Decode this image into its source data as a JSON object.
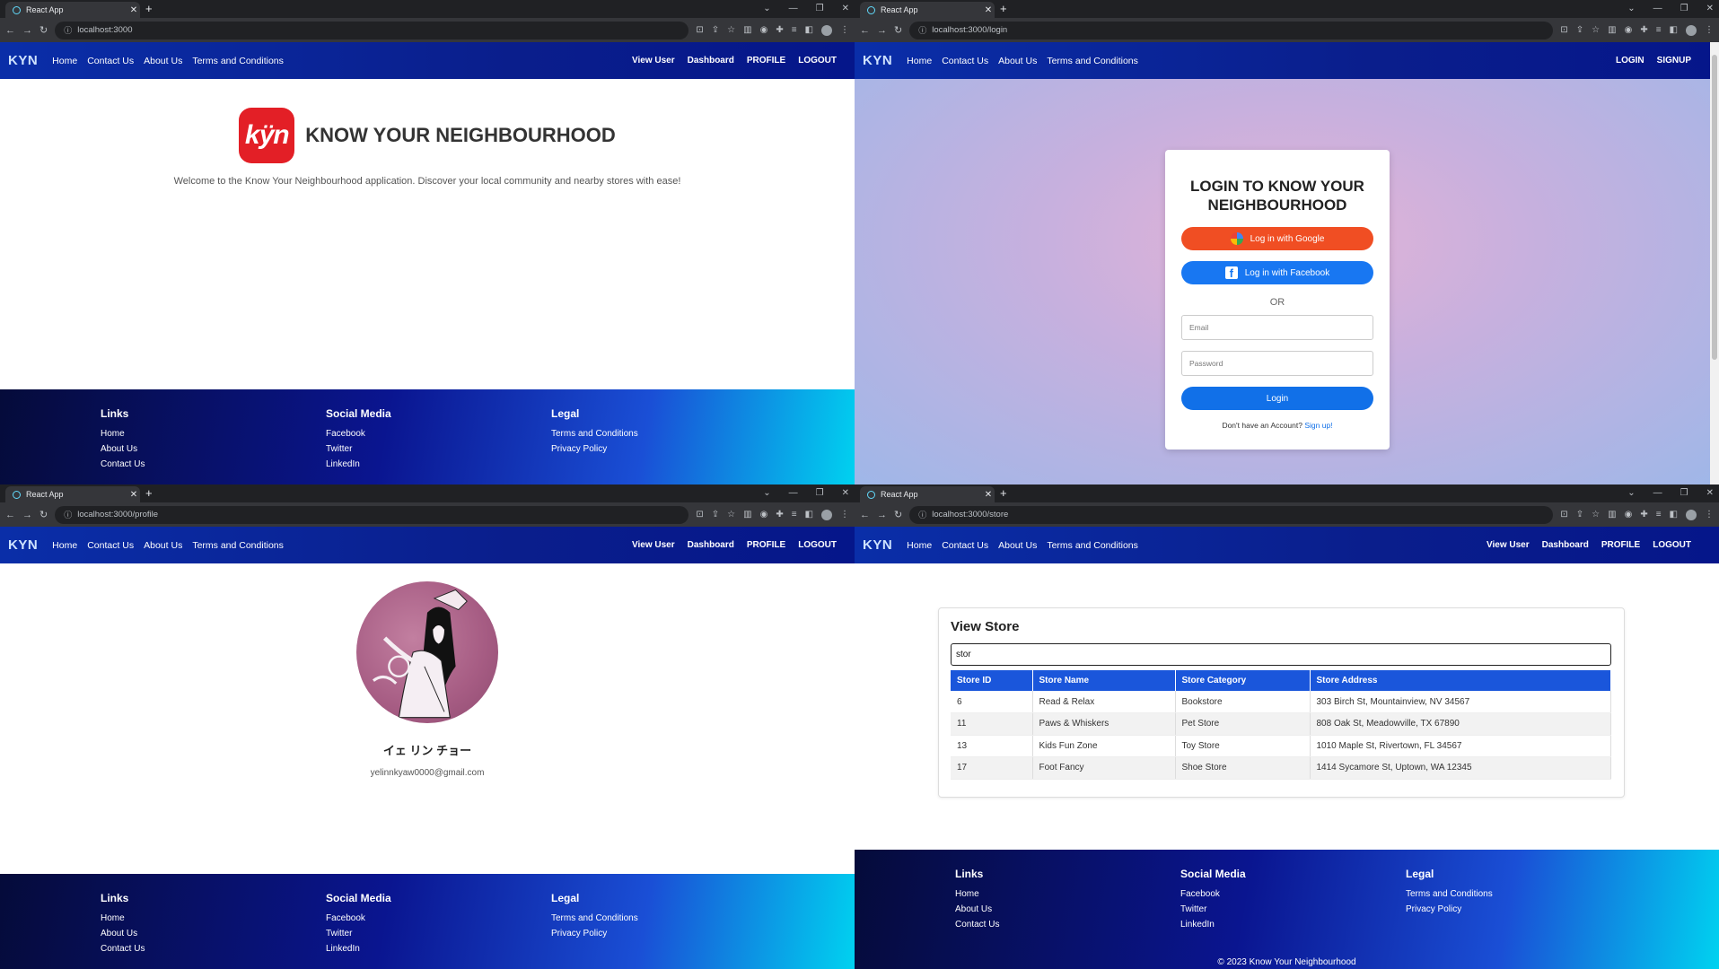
{
  "browser": {
    "tab_title": "React App",
    "tab_close": "✕",
    "new_tab": "+",
    "winctl": [
      "⌄",
      "—",
      "❐",
      "✕"
    ],
    "urls": {
      "home": "localhost:3000",
      "login": "localhost:3000/login",
      "profile": "localhost:3000/profile",
      "store": "localhost:3000/store"
    }
  },
  "nav": {
    "brand": "KYN",
    "links": [
      "Home",
      "Contact Us",
      "About Us",
      "Terms and Conditions"
    ],
    "auth_links": [
      "View User",
      "Dashboard",
      "PROFILE",
      "LOGOUT"
    ],
    "guest_links": [
      "LOGIN",
      "SIGNUP"
    ]
  },
  "footer": {
    "links_title": "Links",
    "links": [
      "Home",
      "About Us",
      "Contact Us"
    ],
    "social_title": "Social Media",
    "social": [
      "Facebook",
      "Twitter",
      "LinkedIn"
    ],
    "legal_title": "Legal",
    "legal": [
      "Terms and Conditions",
      "Privacy Policy"
    ],
    "copyright": "© 2023 Know Your Neighbourhood"
  },
  "home": {
    "logo_text": "kÿn",
    "title": "KNOW YOUR NEIGHBOURHOOD",
    "subtitle": "Welcome to the Know Your Neighbourhood application. Discover your local community and nearby stores with ease!"
  },
  "login": {
    "title": "LOGIN TO KNOW YOUR NEIGHBOURHOOD",
    "google": "Log in with Google",
    "facebook": "Log in with Facebook",
    "or": "OR",
    "email_placeholder": "Email",
    "password_placeholder": "Password",
    "login_button": "Login",
    "no_account": "Don't have an Account?",
    "signup_link": "Sign up!"
  },
  "profile": {
    "name": "イェ リン チョー",
    "email": "yelinnkyaw0000@gmail.com"
  },
  "store": {
    "title": "View Store",
    "search_value": "stor",
    "columns": [
      "Store ID",
      "Store Name",
      "Store Category",
      "Store Address"
    ],
    "rows": [
      [
        "6",
        "Read & Relax",
        "Bookstore",
        "303 Birch St, Mountainview, NV 34567"
      ],
      [
        "11",
        "Paws & Whiskers",
        "Pet Store",
        "808 Oak St, Meadowville, TX 67890"
      ],
      [
        "13",
        "Kids Fun Zone",
        "Toy Store",
        "1010 Maple St, Rivertown, FL 34567"
      ],
      [
        "17",
        "Foot Fancy",
        "Shoe Store",
        "1414 Sycamore St, Uptown, WA 12345"
      ]
    ]
  },
  "colors": {
    "nav_blue": "#0a2ea8",
    "table_header": "#1a56db",
    "google_red": "#f04e23",
    "facebook_blue": "#1877f2",
    "logo_red": "#e31f26"
  }
}
